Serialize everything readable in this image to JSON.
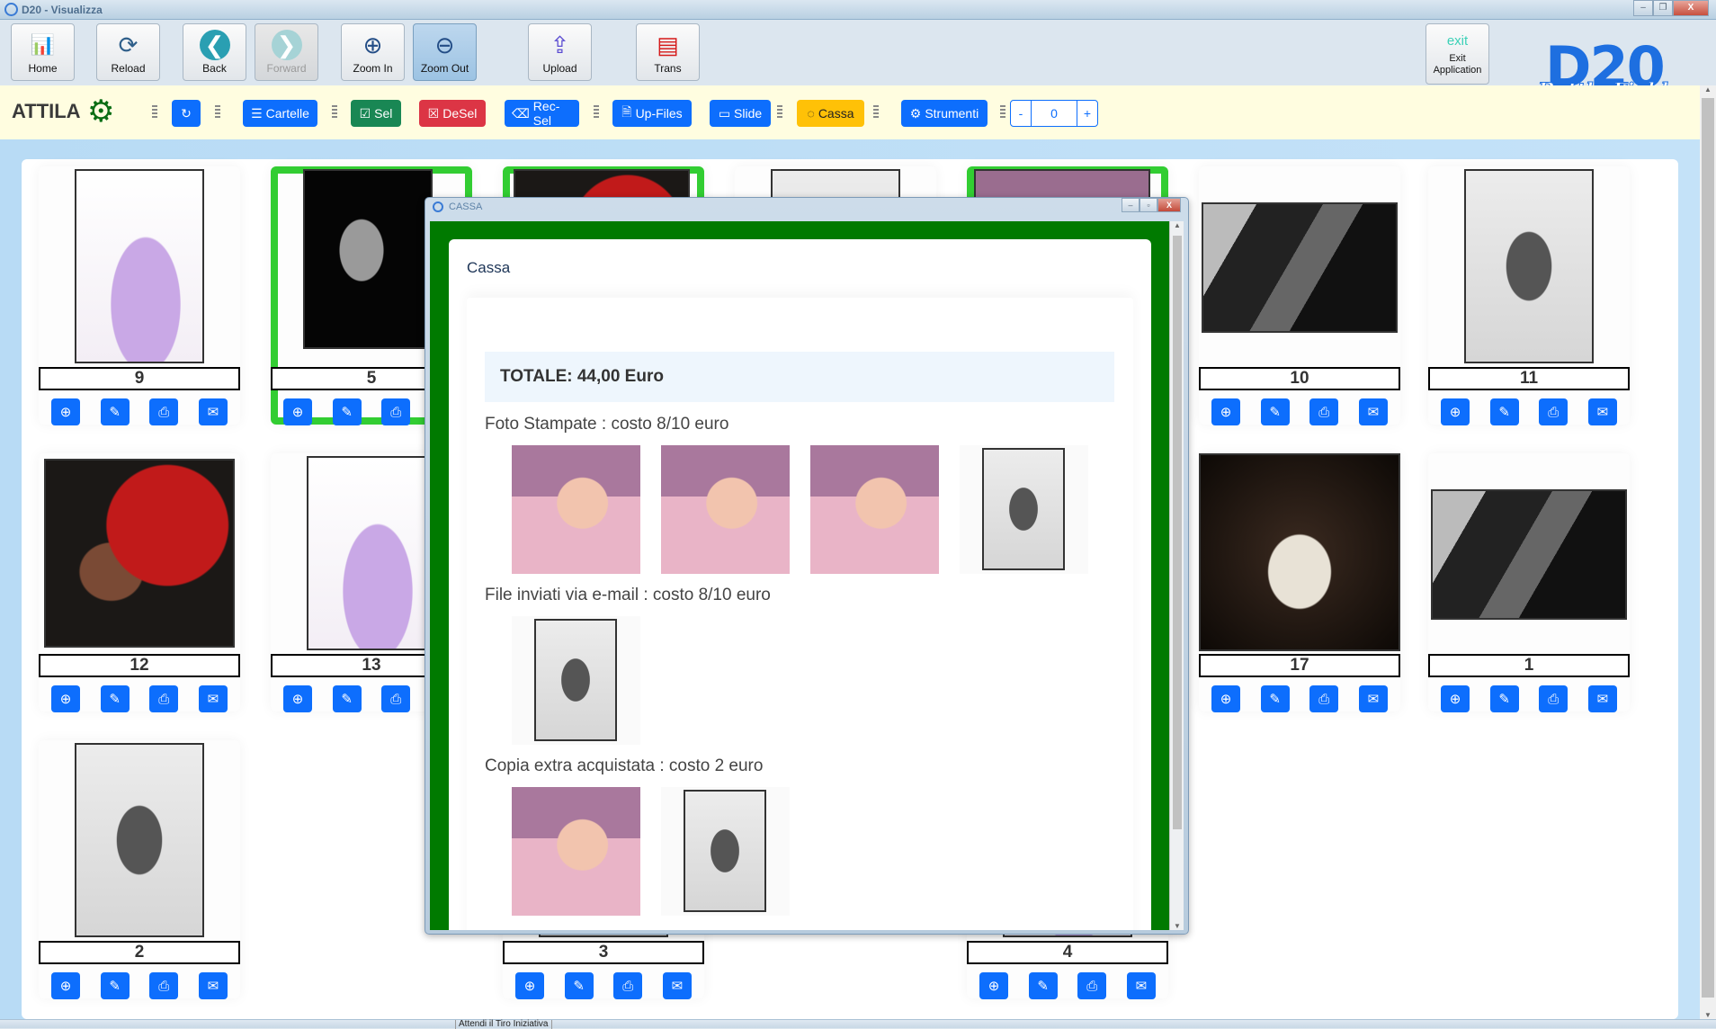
{
  "window": {
    "title": "D20 - Visualizza",
    "controls": {
      "minimize": "–",
      "restore": "❐",
      "close": "X"
    }
  },
  "toolbar": {
    "buttons": [
      {
        "label": "Home",
        "icon": "dashboard-icon",
        "glyph": "📊"
      },
      {
        "label": "Reload",
        "icon": "reload-icon",
        "glyph": "⟳"
      },
      {
        "label": "Back",
        "icon": "back-icon",
        "glyph": "❮"
      },
      {
        "label": "Forward",
        "icon": "forward-icon",
        "glyph": "❯"
      },
      {
        "label": "Zoom In",
        "icon": "zoom-in-icon",
        "glyph": "⊕"
      },
      {
        "label": "Zoom Out",
        "icon": "zoom-out-icon",
        "glyph": "⊖"
      },
      {
        "label": "Upload",
        "icon": "upload-icon",
        "glyph": "⇪"
      },
      {
        "label": "Trans",
        "icon": "trans-icon",
        "glyph": "▤"
      },
      {
        "label": "Exit Application",
        "icon": "exit-icon",
        "glyph": "exit"
      }
    ],
    "logo_text": "D20",
    "logo_subtitle": "Battle Field"
  },
  "actionbar": {
    "user": "ATTILA",
    "refresh_glyph": "↻",
    "buttons": {
      "cartelle": "Cartelle",
      "sel": "Sel",
      "desel": "DeSel",
      "recsel": "Rec-Sel",
      "upfiles": "Up-Files",
      "slide": "Slide",
      "cassa": "Cassa",
      "strumenti": "Strumenti"
    },
    "stepper": {
      "minus": "-",
      "value": "0",
      "plus": "+"
    }
  },
  "grid": {
    "cards": [
      {
        "number": "9",
        "selected": false
      },
      {
        "number": "5",
        "selected": true
      },
      {
        "number": "",
        "selected": true
      },
      {
        "number": "",
        "selected": false
      },
      {
        "number": "",
        "selected": true
      },
      {
        "number": "10",
        "selected": false
      },
      {
        "number": "11",
        "selected": false
      },
      {
        "number": "12",
        "selected": false
      },
      {
        "number": "13",
        "selected": false
      },
      {
        "number": "17",
        "selected": false
      },
      {
        "number": "1",
        "selected": false
      },
      {
        "number": "2",
        "selected": false
      },
      {
        "number": "3",
        "selected": false
      },
      {
        "number": "4",
        "selected": false
      }
    ],
    "card_actions": [
      "zoom-button",
      "edit-button",
      "print-button",
      "email-button"
    ]
  },
  "modal": {
    "window_title": "CASSA",
    "heading": "Cassa",
    "total": "TOTALE: 44,00 Euro",
    "sections": [
      {
        "label": "Foto Stampate : costo 8/10 euro",
        "items": [
          "baby",
          "baby",
          "baby",
          "bw-portrait"
        ]
      },
      {
        "label": "File inviati via e-mail : costo 8/10 euro",
        "items": [
          "bw-portrait"
        ]
      },
      {
        "label": "Copia extra acquistata : costo 2 euro",
        "items": [
          "baby",
          "bw-portrait"
        ]
      }
    ]
  },
  "statusbar": {
    "text": "Attendi il Tiro Iniziativa"
  },
  "colors": {
    "primary": "#0d6efd",
    "success": "#198754",
    "danger": "#dc3545",
    "warning": "#ffc107",
    "selected_border": "#32cd32",
    "modal_frame": "#007a00",
    "actionbar_bg": "#fffde0"
  }
}
